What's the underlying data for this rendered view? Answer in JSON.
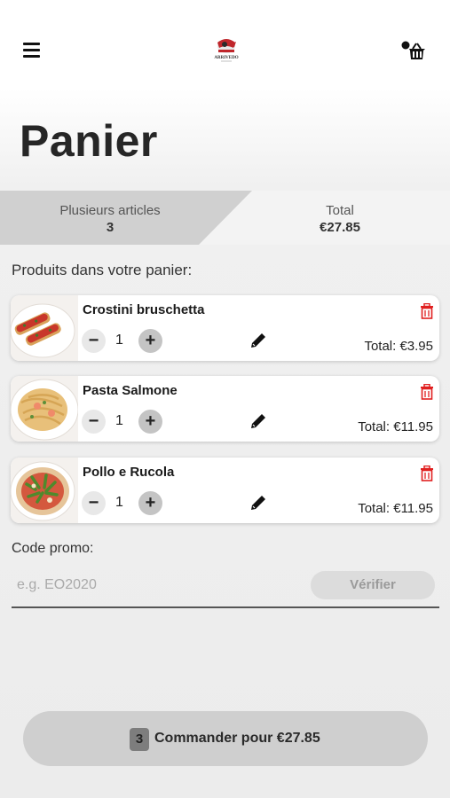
{
  "header": {
    "menu_icon": "hamburger-menu-icon",
    "logo_text": "ARRIVEDO",
    "cart_icon": "shopping-basket-icon"
  },
  "page": {
    "title": "Panier"
  },
  "summary": {
    "items_label": "Plusieurs articles",
    "items_count": "3",
    "total_label": "Total",
    "total_value": "€27.85"
  },
  "cart": {
    "section_title": "Produits dans votre panier:",
    "items": [
      {
        "name": "Crostini bruschetta",
        "quantity": "1",
        "minus": "−",
        "plus": "+",
        "total": "Total: €3.95"
      },
      {
        "name": "Pasta Salmone",
        "quantity": "1",
        "minus": "−",
        "plus": "+",
        "total": "Total: €11.95"
      },
      {
        "name": "Pollo e Rucola",
        "quantity": "1",
        "minus": "−",
        "plus": "+",
        "total": "Total: €11.95"
      }
    ]
  },
  "promo": {
    "label": "Code promo:",
    "placeholder": "e.g. EO2020",
    "value": "",
    "verify_label": "Vérifier"
  },
  "order": {
    "count": "3",
    "label": "Commander pour €27.85"
  },
  "colors": {
    "delete_red": "#e02020",
    "summary_active_bg": "#d0d0d0",
    "order_button_bg": "#cfcfcf"
  }
}
